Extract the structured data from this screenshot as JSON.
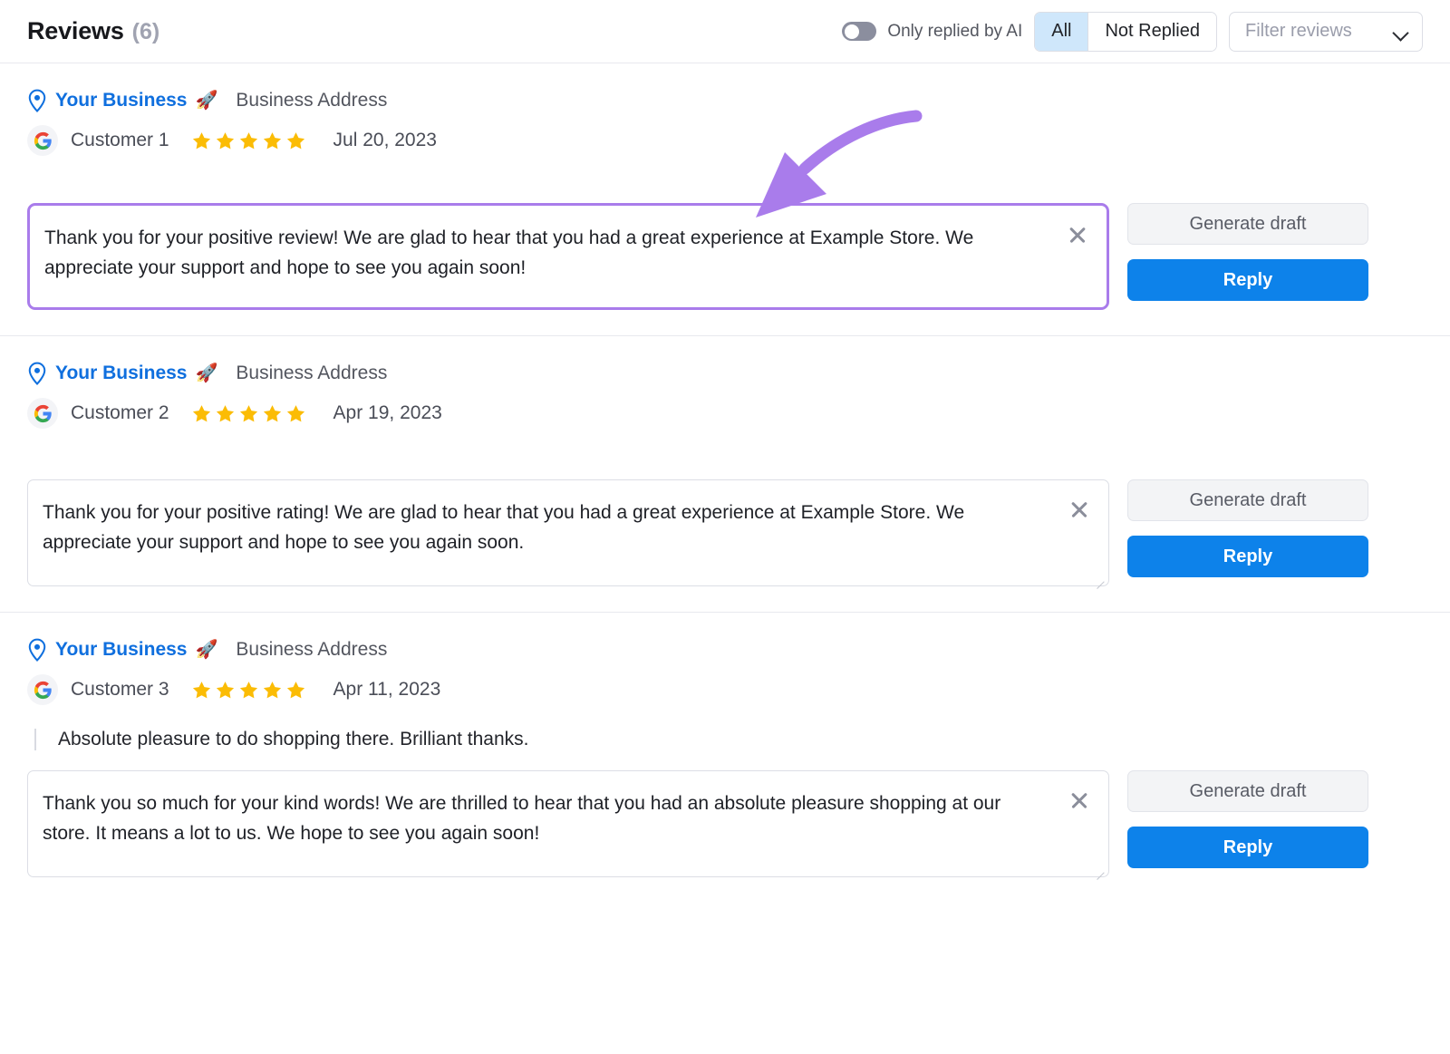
{
  "header": {
    "title": "Reviews",
    "count": "(6)",
    "ai_toggle_label": "Only replied by AI",
    "ai_toggle_on": false,
    "segments": [
      {
        "label": "All",
        "active": true
      },
      {
        "label": "Not Replied",
        "active": false
      }
    ],
    "filter_placeholder": "Filter reviews",
    "chevron_icon": "chevron-down-icon"
  },
  "colors": {
    "accent_blue": "#0d82ea",
    "brand_link": "#0f6fde",
    "star_yellow": "#fbbc05",
    "highlight_purple": "#a97ceb",
    "segment_active_bg": "#cfe7fb"
  },
  "buttons": {
    "generate_draft": "Generate draft",
    "reply": "Reply"
  },
  "reviews": [
    {
      "business_name": "Your Business",
      "business_emoji": "🚀",
      "business_address": "Business Address",
      "source_icon": "google-icon",
      "customer": "Customer 1",
      "rating": 5,
      "date": "Jul 20, 2023",
      "review_text": "",
      "reply_draft": "Thank you for your positive review! We are glad to hear that you had a great experience at Example Store. We appreciate your support and hope to see you again soon!",
      "highlighted": true
    },
    {
      "business_name": "Your Business",
      "business_emoji": "🚀",
      "business_address": "Business Address",
      "source_icon": "google-icon",
      "customer": "Customer 2",
      "rating": 5,
      "date": "Apr 19, 2023",
      "review_text": "",
      "reply_draft": "Thank you for your positive rating! We are glad to hear that you had a great experience at Example Store. We appreciate your support and hope to see you again soon.",
      "highlighted": false
    },
    {
      "business_name": "Your Business",
      "business_emoji": "🚀",
      "business_address": "Business Address",
      "source_icon": "google-icon",
      "customer": "Customer 3",
      "rating": 5,
      "date": "Apr 11, 2023",
      "review_text": "Absolute pleasure to do shopping there. Brilliant thanks.",
      "reply_draft": "Thank you so much for your kind words! We are thrilled to hear that you had an absolute pleasure shopping at our store. It means a lot to us. We hope to see you again soon!",
      "highlighted": false
    }
  ],
  "annotation": {
    "type": "curved-arrow",
    "color": "#a97ceb",
    "points_to": "reply-textarea-1"
  }
}
